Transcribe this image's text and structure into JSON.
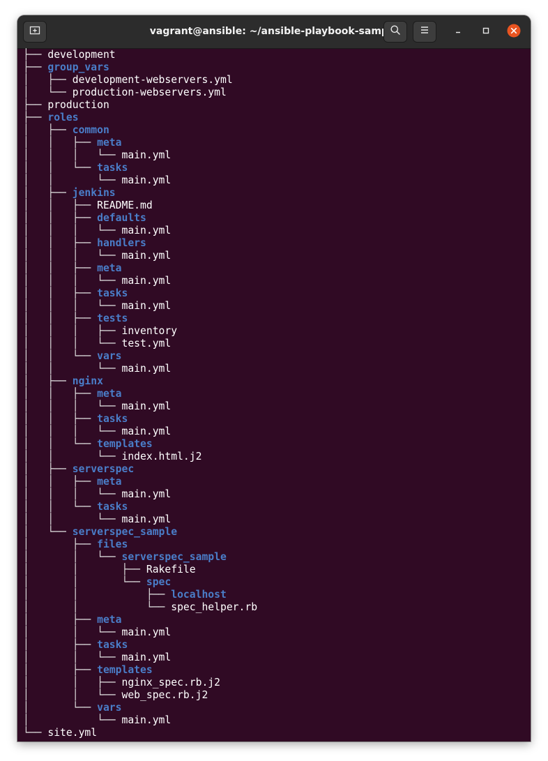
{
  "window": {
    "title": "vagrant@ansible: ~/ansible-playbook-sample",
    "new_tab_icon": "new-tab-icon",
    "search_icon": "search-icon",
    "menu_icon": "hamburger-menu-icon",
    "minimize_icon": "minimize-icon",
    "maximize_icon": "maximize-icon",
    "close_icon": "close-icon",
    "colors": {
      "terminal_bg": "#300a24",
      "titlebar_bg": "#2c2c2c",
      "directory": "#4a7dc8",
      "file": "#ffffff",
      "close_button": "#e95420"
    }
  },
  "tree": [
    {
      "prefix": "├── ",
      "name": "development",
      "type": "file"
    },
    {
      "prefix": "├── ",
      "name": "group_vars",
      "type": "dir"
    },
    {
      "prefix": "│   ├── ",
      "name": "development-webservers.yml",
      "type": "file"
    },
    {
      "prefix": "│   └── ",
      "name": "production-webservers.yml",
      "type": "file"
    },
    {
      "prefix": "├── ",
      "name": "production",
      "type": "file"
    },
    {
      "prefix": "├── ",
      "name": "roles",
      "type": "dir"
    },
    {
      "prefix": "│   ├── ",
      "name": "common",
      "type": "dir"
    },
    {
      "prefix": "│   │   ├── ",
      "name": "meta",
      "type": "dir"
    },
    {
      "prefix": "│   │   │   └── ",
      "name": "main.yml",
      "type": "file"
    },
    {
      "prefix": "│   │   └── ",
      "name": "tasks",
      "type": "dir"
    },
    {
      "prefix": "│   │       └── ",
      "name": "main.yml",
      "type": "file"
    },
    {
      "prefix": "│   ├── ",
      "name": "jenkins",
      "type": "dir"
    },
    {
      "prefix": "│   │   ├── ",
      "name": "README.md",
      "type": "file"
    },
    {
      "prefix": "│   │   ├── ",
      "name": "defaults",
      "type": "dir"
    },
    {
      "prefix": "│   │   │   └── ",
      "name": "main.yml",
      "type": "file"
    },
    {
      "prefix": "│   │   ├── ",
      "name": "handlers",
      "type": "dir"
    },
    {
      "prefix": "│   │   │   └── ",
      "name": "main.yml",
      "type": "file"
    },
    {
      "prefix": "│   │   ├── ",
      "name": "meta",
      "type": "dir"
    },
    {
      "prefix": "│   │   │   └── ",
      "name": "main.yml",
      "type": "file"
    },
    {
      "prefix": "│   │   ├── ",
      "name": "tasks",
      "type": "dir"
    },
    {
      "prefix": "│   │   │   └── ",
      "name": "main.yml",
      "type": "file"
    },
    {
      "prefix": "│   │   ├── ",
      "name": "tests",
      "type": "dir"
    },
    {
      "prefix": "│   │   │   ├── ",
      "name": "inventory",
      "type": "file"
    },
    {
      "prefix": "│   │   │   └── ",
      "name": "test.yml",
      "type": "file"
    },
    {
      "prefix": "│   │   └── ",
      "name": "vars",
      "type": "dir"
    },
    {
      "prefix": "│   │       └── ",
      "name": "main.yml",
      "type": "file"
    },
    {
      "prefix": "│   ├── ",
      "name": "nginx",
      "type": "dir"
    },
    {
      "prefix": "│   │   ├── ",
      "name": "meta",
      "type": "dir"
    },
    {
      "prefix": "│   │   │   └── ",
      "name": "main.yml",
      "type": "file"
    },
    {
      "prefix": "│   │   ├── ",
      "name": "tasks",
      "type": "dir"
    },
    {
      "prefix": "│   │   │   └── ",
      "name": "main.yml",
      "type": "file"
    },
    {
      "prefix": "│   │   └── ",
      "name": "templates",
      "type": "dir"
    },
    {
      "prefix": "│   │       └── ",
      "name": "index.html.j2",
      "type": "file"
    },
    {
      "prefix": "│   ├── ",
      "name": "serverspec",
      "type": "dir"
    },
    {
      "prefix": "│   │   ├── ",
      "name": "meta",
      "type": "dir"
    },
    {
      "prefix": "│   │   │   └── ",
      "name": "main.yml",
      "type": "file"
    },
    {
      "prefix": "│   │   └── ",
      "name": "tasks",
      "type": "dir"
    },
    {
      "prefix": "│   │       └── ",
      "name": "main.yml",
      "type": "file"
    },
    {
      "prefix": "│   └── ",
      "name": "serverspec_sample",
      "type": "dir"
    },
    {
      "prefix": "│       ├── ",
      "name": "files",
      "type": "dir"
    },
    {
      "prefix": "│       │   └── ",
      "name": "serverspec_sample",
      "type": "dir"
    },
    {
      "prefix": "│       │       ├── ",
      "name": "Rakefile",
      "type": "file"
    },
    {
      "prefix": "│       │       └── ",
      "name": "spec",
      "type": "dir"
    },
    {
      "prefix": "│       │           ├── ",
      "name": "localhost",
      "type": "dir"
    },
    {
      "prefix": "│       │           └── ",
      "name": "spec_helper.rb",
      "type": "file"
    },
    {
      "prefix": "│       ├── ",
      "name": "meta",
      "type": "dir"
    },
    {
      "prefix": "│       │   └── ",
      "name": "main.yml",
      "type": "file"
    },
    {
      "prefix": "│       ├── ",
      "name": "tasks",
      "type": "dir"
    },
    {
      "prefix": "│       │   └── ",
      "name": "main.yml",
      "type": "file"
    },
    {
      "prefix": "│       ├── ",
      "name": "templates",
      "type": "dir"
    },
    {
      "prefix": "│       │   ├── ",
      "name": "nginx_spec.rb.j2",
      "type": "file"
    },
    {
      "prefix": "│       │   └── ",
      "name": "web_spec.rb.j2",
      "type": "file"
    },
    {
      "prefix": "│       └── ",
      "name": "vars",
      "type": "dir"
    },
    {
      "prefix": "│           └── ",
      "name": "main.yml",
      "type": "file"
    },
    {
      "prefix": "└── ",
      "name": "site.yml",
      "type": "file"
    }
  ]
}
